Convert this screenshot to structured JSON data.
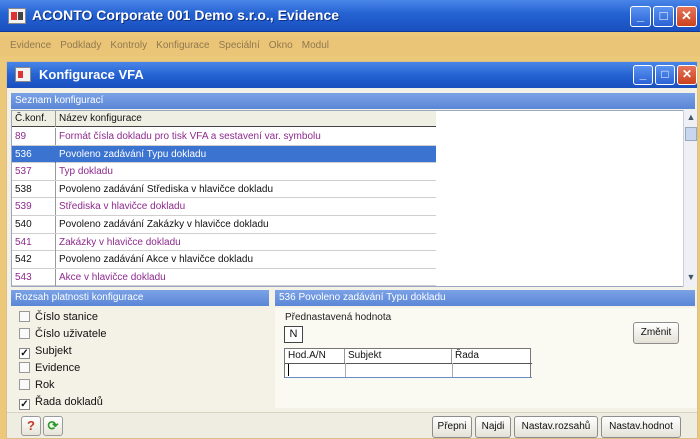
{
  "window": {
    "title": "ACONTO Corporate 001 Demo s.r.o., Evidence",
    "buttons": {
      "minimize": "_",
      "maximize": "□",
      "close": "✕"
    }
  },
  "menu": [
    "Evidence",
    "Podklady",
    "Kontroly",
    "Konfigurace",
    "Speciální",
    "Okno",
    "Modul"
  ],
  "dialog": {
    "title": "Konfigurace VFA",
    "buttons": {
      "minimize": "_",
      "maximize": "□",
      "close": "✕"
    }
  },
  "config_list": {
    "header": "Seznam konfigurací",
    "columns": [
      "Č.konf.",
      "Název konfigurace"
    ],
    "rows": [
      {
        "num": "89",
        "name": "Formát čísla dokladu pro tisk VFA a sestavení var. symbolu",
        "style": "purple"
      },
      {
        "num": "536",
        "name": "Povoleno zadávání Typu dokladu",
        "style": "selected"
      },
      {
        "num": "537",
        "name": "Typ dokladu",
        "style": "purple"
      },
      {
        "num": "538",
        "name": "Povoleno zadávání Střediska v hlavičce dokladu",
        "style": "normal"
      },
      {
        "num": "539",
        "name": "Střediska v hlavičce dokladu",
        "style": "purple"
      },
      {
        "num": "540",
        "name": "Povoleno zadávání Zakázky v hlavičce dokladu",
        "style": "normal"
      },
      {
        "num": "541",
        "name": "Zakázky v hlavičce dokladu",
        "style": "purple"
      },
      {
        "num": "542",
        "name": "Povoleno zadávání Akce v hlavičce dokladu",
        "style": "normal"
      },
      {
        "num": "543",
        "name": "Akce v hlavičce dokladu",
        "style": "purple"
      }
    ],
    "scroll_up": "▲",
    "scroll_down": "▼"
  },
  "scope": {
    "header": "Rozsah platnosti konfigurace",
    "items": [
      {
        "label": "Číslo stanice",
        "checked": false
      },
      {
        "label": "Číslo uživatele",
        "checked": false
      },
      {
        "label": "Subjekt",
        "checked": true
      },
      {
        "label": "Evidence",
        "checked": false
      },
      {
        "label": "Rok",
        "checked": false
      },
      {
        "label": "Řada dokladů",
        "checked": true
      }
    ],
    "check_mark": "✓"
  },
  "detail": {
    "header": "536 Povoleno zadávání Typu dokladu",
    "preset_label": "Přednastavená hodnota",
    "preset_value": "N",
    "change_button": "Změnit",
    "columns": [
      "Hod.A/N",
      "Subjekt",
      "Řada"
    ]
  },
  "footer": {
    "help_icon": "?",
    "refresh_icon": "⟳",
    "buttons": [
      "Přepni",
      "Najdi",
      "Nastav.rozsahů",
      "Nastav.hodnot"
    ]
  },
  "colors": {
    "desktop": "#ecc97a",
    "titlebar": "#2462d2",
    "selection": "#3b73d1",
    "purple_text": "#8e2a8e"
  }
}
